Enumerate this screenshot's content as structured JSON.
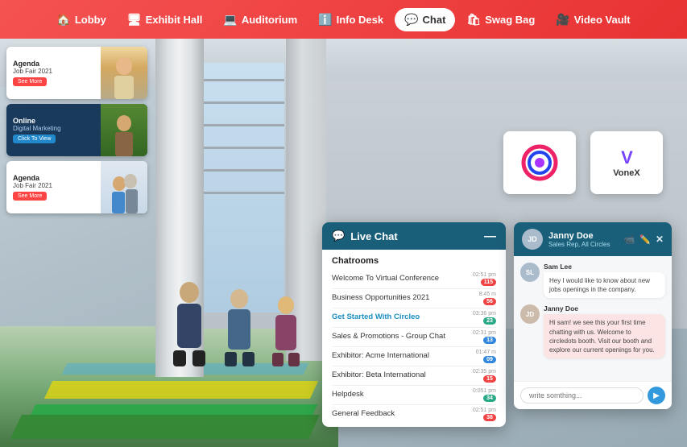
{
  "nav": {
    "items": [
      {
        "id": "lobby",
        "label": "Lobby",
        "icon": "🏠",
        "active": false
      },
      {
        "id": "exhibit-hall",
        "label": "Exhibit Hall",
        "icon": "🖥",
        "active": false
      },
      {
        "id": "auditorium",
        "label": "Auditorium",
        "icon": "💻",
        "active": false
      },
      {
        "id": "info-desk",
        "label": "Info Desk",
        "icon": "ℹ️",
        "active": false
      },
      {
        "id": "chat",
        "label": "Chat",
        "icon": "💬",
        "active": true
      },
      {
        "id": "swag-bag",
        "label": "Swag Bag",
        "icon": "🛍",
        "active": false
      },
      {
        "id": "video-vault",
        "label": "Video Vault",
        "icon": "🎥",
        "active": false
      }
    ]
  },
  "agenda_cards": [
    {
      "title": "Agenda",
      "subtitle": "Job Fair 2021",
      "btn_label": "See More",
      "btn_color": "#f44"
    },
    {
      "title": "Online",
      "subtitle": "Digital Marketing",
      "btn_label": "Click To View",
      "btn_color": "#2288cc"
    },
    {
      "title": "Agenda",
      "subtitle": "Job Fair 2021",
      "btn_label": "See More",
      "btn_color": "#f44"
    }
  ],
  "live_chat": {
    "header_label": "Live Chat",
    "minimize_icon": "—",
    "chatrooms_title": "Chatrooms",
    "chatrooms": [
      {
        "name": "Welcome To Virtual Conference",
        "time": "02:51 pm",
        "badge": "115",
        "badge_color": "red",
        "active": false
      },
      {
        "name": "Business Opportunities 2021",
        "time": "8:45 m",
        "badge": "56",
        "badge_color": "red",
        "active": false
      },
      {
        "name": "Get Started With Circleo",
        "time": "03:36 pm",
        "badge": "23",
        "badge_color": "teal",
        "active": true
      },
      {
        "name": "Sales & Promotions - Group Chat",
        "time": "02:31 pm",
        "badge": "13",
        "badge_color": "blue",
        "active": false
      },
      {
        "name": "Exhibitor: Acme International",
        "time": "01:47 m",
        "badge": "09",
        "badge_color": "blue",
        "active": false
      },
      {
        "name": "Exhibitor: Beta International",
        "time": "02:35 pm",
        "badge": "15",
        "badge_color": "red",
        "active": false
      },
      {
        "name": "Helpdesk",
        "time": "0:051 pm",
        "badge": "34",
        "badge_color": "teal",
        "active": false
      },
      {
        "name": "General Feedback",
        "time": "02:51 pm",
        "badge": "38",
        "badge_color": "red",
        "active": false
      }
    ]
  },
  "right_chat": {
    "user_name": "Janny Doe",
    "user_role": "Sales Rep, All Circles",
    "actions": [
      "📹",
      "✏️",
      "✕"
    ],
    "messages": [
      {
        "sender": "Sam Lee",
        "avatar_initials": "SL",
        "avatar_color": "#aabbcc",
        "text": "Hey I would like to  know about new jobs openings in the company.",
        "pink": false
      },
      {
        "sender": "Janny Doe",
        "avatar_initials": "JD",
        "avatar_color": "#ccbbaa",
        "text": "Hi sam! we see this your first time chatting with us. Welcome to circledots booth. Visit our booth and explore our current openings for you.",
        "pink": true
      }
    ],
    "input_placeholder": "write somthing...",
    "send_icon": "▶"
  }
}
